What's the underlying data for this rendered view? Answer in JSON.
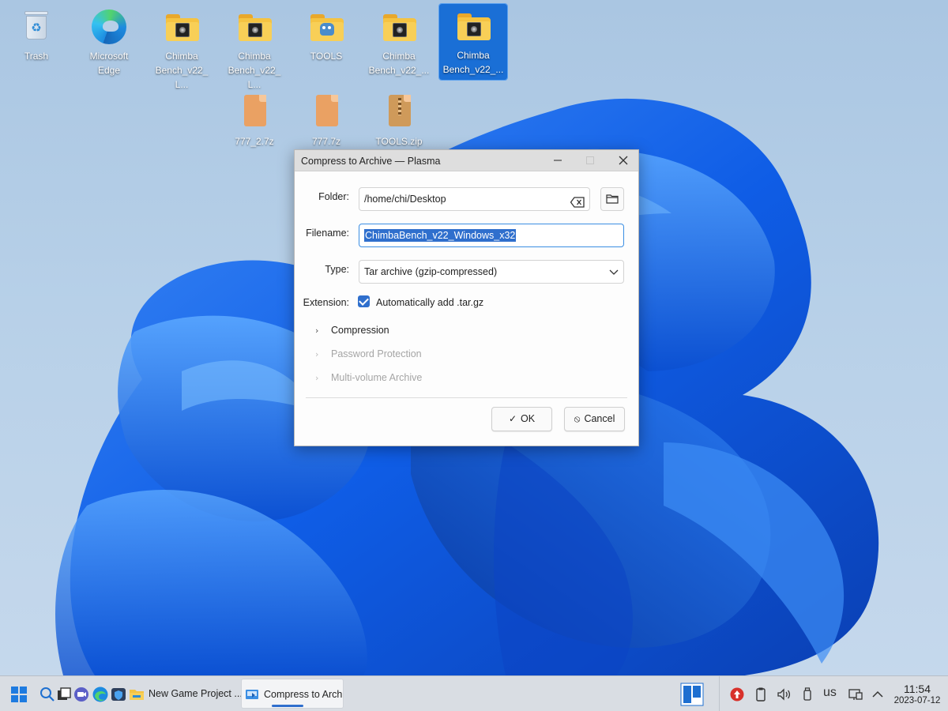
{
  "desktop": {
    "icons": [
      {
        "label": "Trash",
        "kind": "trash"
      },
      {
        "label": "Microsoft\nEdge",
        "kind": "edge"
      },
      {
        "label": "Chimba\nBench_v22_L...",
        "kind": "folder"
      },
      {
        "label": "Chimba\nBench_v22_L...",
        "kind": "folder"
      },
      {
        "label": "TOOLS",
        "kind": "folder-godot"
      },
      {
        "label": "Chimba\nBench_v22_...",
        "kind": "folder"
      },
      {
        "label": "Chimba\nBench_v22_...",
        "kind": "folder",
        "selected": true
      },
      {
        "label": "777_2.7z",
        "kind": "archive"
      },
      {
        "label": "777.7z",
        "kind": "archive"
      },
      {
        "label": "TOOLS.zip",
        "kind": "zip"
      }
    ]
  },
  "dialog": {
    "title": "Compress to Archive — Plasma",
    "folder_label": "Folder:",
    "folder_value": "/home/chi/Desktop",
    "filename_label": "Filename:",
    "filename_value": "ChimbaBench_v22_Windows_x32",
    "type_label": "Type:",
    "type_value": "Tar archive (gzip-compressed)",
    "extension_label": "Extension:",
    "extension_checkbox": "Automatically add .tar.gz",
    "extension_checked": true,
    "sections": [
      {
        "label": "Compression",
        "enabled": true
      },
      {
        "label": "Password Protection",
        "enabled": false
      },
      {
        "label": "Multi-volume Archive",
        "enabled": false
      }
    ],
    "ok_label": "OK",
    "cancel_label": "Cancel"
  },
  "taskbar": {
    "tasks": [
      {
        "label": "New Game Project ...",
        "active": false
      },
      {
        "label": "Compress to Archiv...",
        "active": true
      }
    ],
    "keyboard_layout": "us",
    "time": "11:54",
    "date": "2023-07-12"
  },
  "colors": {
    "accent": "#2f6fcd",
    "selection": "#1a6fd6",
    "taskbar": "#d9dde3",
    "folder": "#f5c342",
    "archive": "#eaa163"
  }
}
